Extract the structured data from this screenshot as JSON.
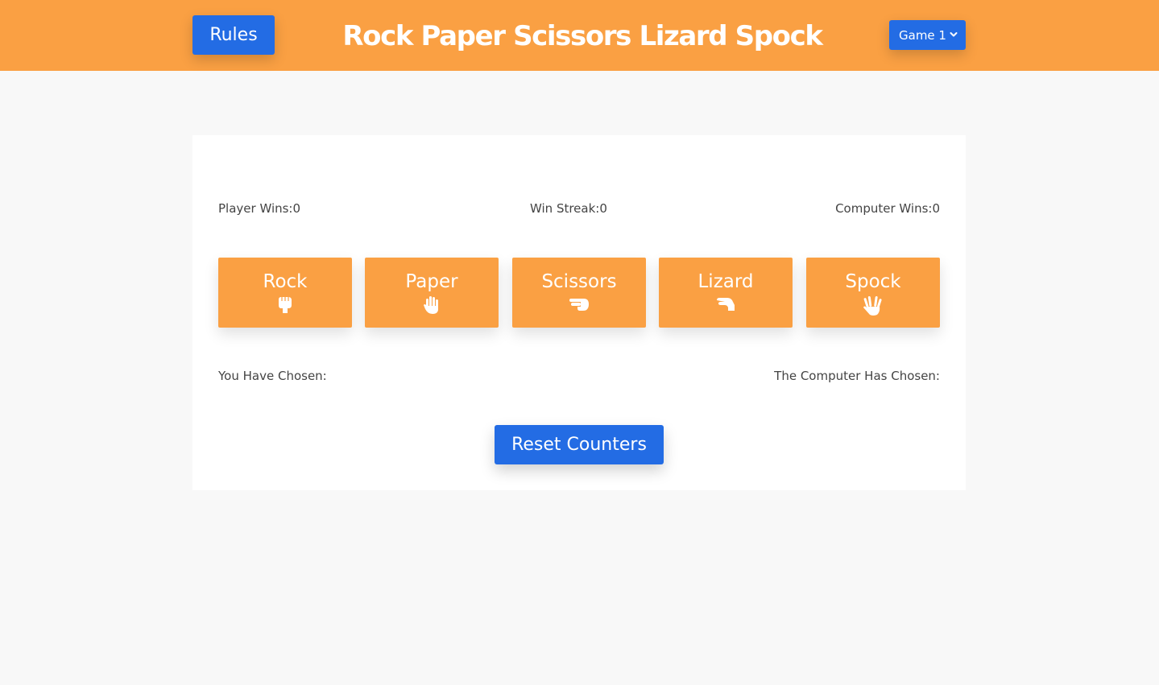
{
  "header": {
    "rules_label": "Rules",
    "title": "Rock Paper Scissors Lizard Spock",
    "game_select": {
      "selected": "Game 1",
      "icon": "chevron-down-icon"
    }
  },
  "stats": {
    "player_wins": "Player Wins:0",
    "win_streak": "Win Streak:0",
    "computer_wins": "Computer Wins:0"
  },
  "choices": [
    {
      "label": "Rock",
      "icon": "hand-rock-icon"
    },
    {
      "label": "Paper",
      "icon": "hand-paper-icon"
    },
    {
      "label": "Scissors",
      "icon": "hand-scissors-icon"
    },
    {
      "label": "Lizard",
      "icon": "hand-lizard-icon"
    },
    {
      "label": "Spock",
      "icon": "hand-spock-icon"
    }
  ],
  "result": {
    "you_chosen": "You Have Chosen:",
    "computer_chosen": "The Computer Has Chosen:"
  },
  "reset_label": "Reset Counters",
  "colors": {
    "accent_orange": "#faa043",
    "button_blue": "#236ce4",
    "background": "#f8f8f8",
    "card": "#ffffff",
    "text": "#444444"
  }
}
